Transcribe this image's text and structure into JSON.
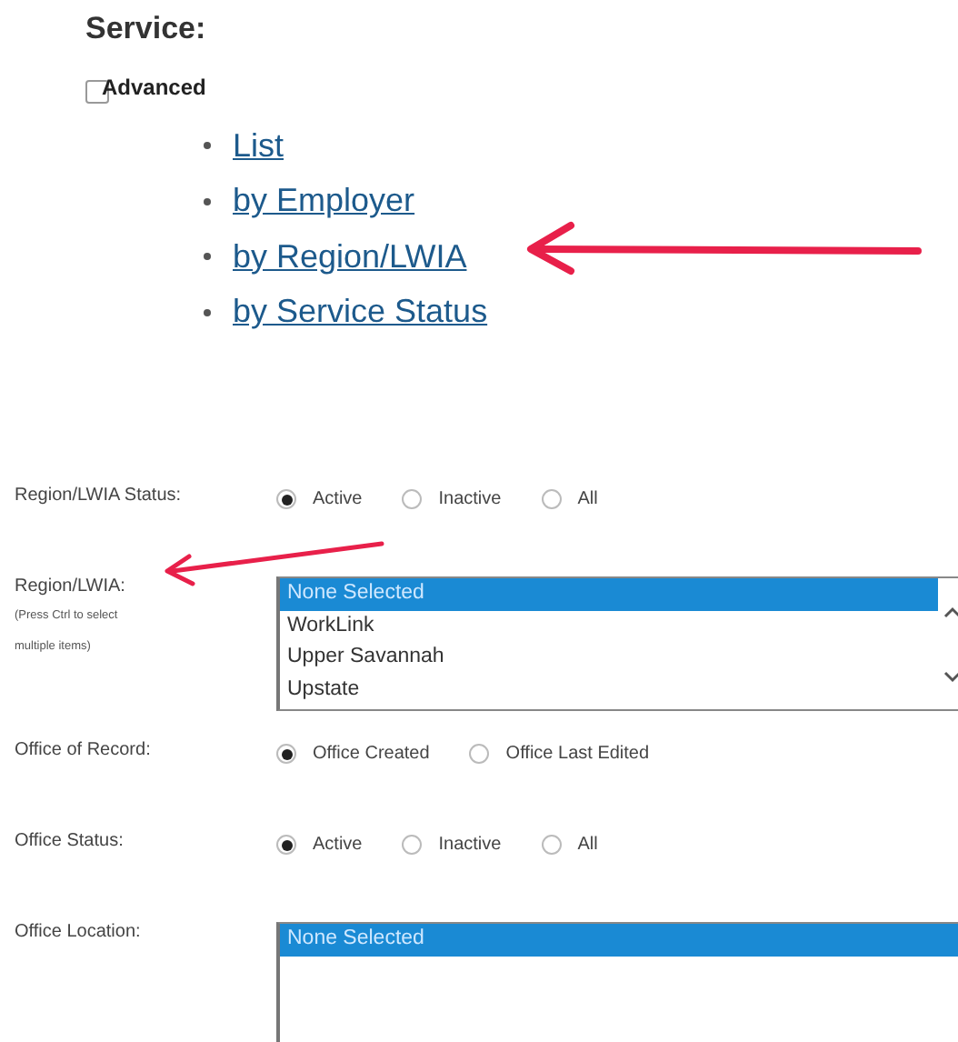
{
  "service": {
    "title": "Service:",
    "advanced": {
      "label": "Advanced",
      "checked": false
    },
    "links": [
      "List",
      "by Employer",
      "by Region/LWIA",
      "by Service Status"
    ]
  },
  "filters": [
    {
      "kind": "radio",
      "label": "Region/LWIA Status:",
      "options": [
        {
          "label": "Active",
          "selected": true
        },
        {
          "label": "Inactive",
          "selected": false
        },
        {
          "label": "All",
          "selected": false
        }
      ]
    },
    {
      "kind": "listbox",
      "label": "Region/LWIA:",
      "hint": "(Press Ctrl to select multiple items)",
      "scrollbar": true,
      "options": [
        {
          "label": "None Selected",
          "selected": true
        },
        {
          "label": "WorkLink",
          "selected": false
        },
        {
          "label": "Upper Savannah",
          "selected": false
        },
        {
          "label": "Upstate",
          "selected": false
        }
      ]
    },
    {
      "kind": "radio",
      "label": "Office of Record:",
      "options": [
        {
          "label": "Office Created",
          "selected": true
        },
        {
          "label": "Office Last Edited",
          "selected": false
        }
      ]
    },
    {
      "kind": "radio",
      "label": "Office Status:",
      "options": [
        {
          "label": "Active",
          "selected": true
        },
        {
          "label": "Inactive",
          "selected": false
        },
        {
          "label": "All",
          "selected": false
        }
      ]
    },
    {
      "kind": "listbox",
      "label": "Office Location:",
      "scrollbar": false,
      "options": [
        {
          "label": "None Selected",
          "selected": true
        }
      ]
    }
  ]
}
